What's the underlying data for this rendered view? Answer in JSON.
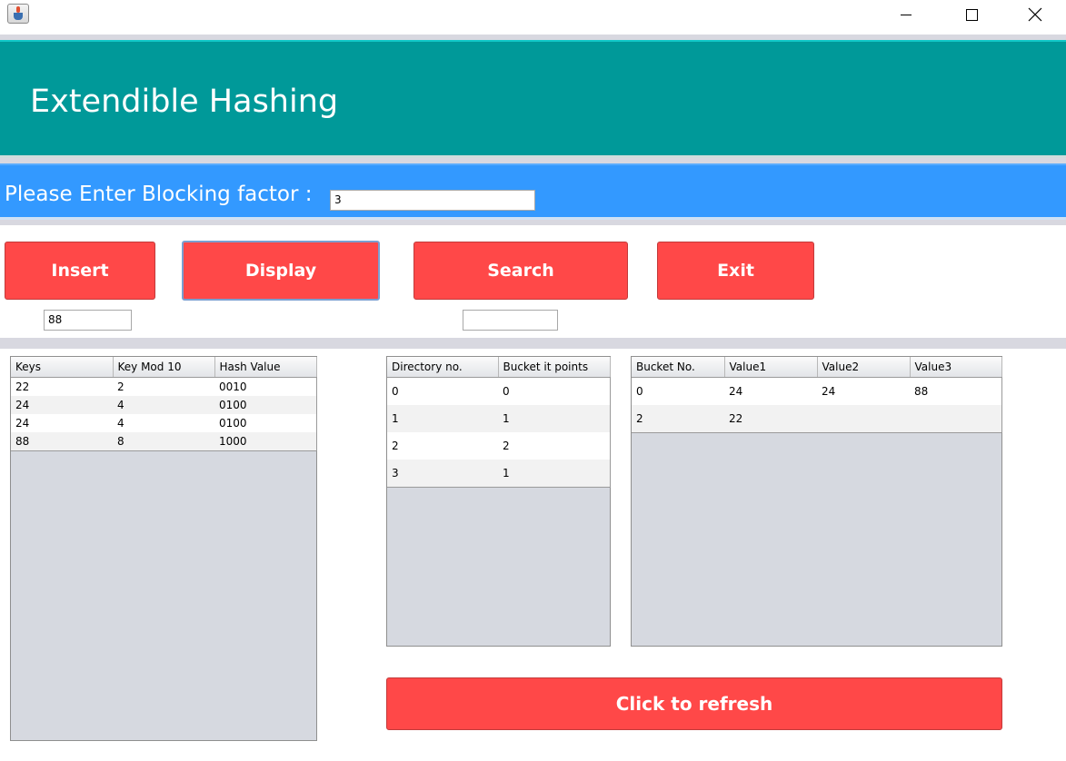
{
  "window": {
    "icon": "java-app-icon",
    "controls": [
      "minimize-icon",
      "maximize-icon",
      "close-icon"
    ]
  },
  "header": {
    "title": "Extendible Hashing"
  },
  "blocking": {
    "label": "Please Enter Blocking factor :",
    "value": "3"
  },
  "buttons": {
    "insert": "Insert",
    "display": "Display",
    "search": "Search",
    "exit": "Exit",
    "refresh": "Click to refresh"
  },
  "insert_input": {
    "value": "88"
  },
  "search_input": {
    "value": ""
  },
  "keys_table": {
    "headers": [
      "Keys",
      "Key Mod 10",
      "Hash Value"
    ],
    "rows": [
      [
        "22",
        "2",
        "0010"
      ],
      [
        "24",
        "4",
        "0100"
      ],
      [
        "24",
        "4",
        "0100"
      ],
      [
        "88",
        "8",
        "1000"
      ]
    ]
  },
  "directory_table": {
    "headers": [
      "Directory no.",
      "Bucket it points"
    ],
    "rows": [
      [
        "0",
        "0"
      ],
      [
        "1",
        "1"
      ],
      [
        "2",
        "2"
      ],
      [
        "3",
        "1"
      ]
    ]
  },
  "bucket_table": {
    "headers": [
      "Bucket No.",
      "Value1",
      "Value2",
      "Value3"
    ],
    "rows": [
      [
        "0",
        "24",
        "24",
        "88"
      ],
      [
        "2",
        "22",
        "",
        ""
      ]
    ]
  },
  "colors": {
    "header_bg": "#009999",
    "blocking_bar_bg": "#3399ff",
    "button_bg": "#ff4848",
    "panel_bg": "#d6d9e0"
  }
}
